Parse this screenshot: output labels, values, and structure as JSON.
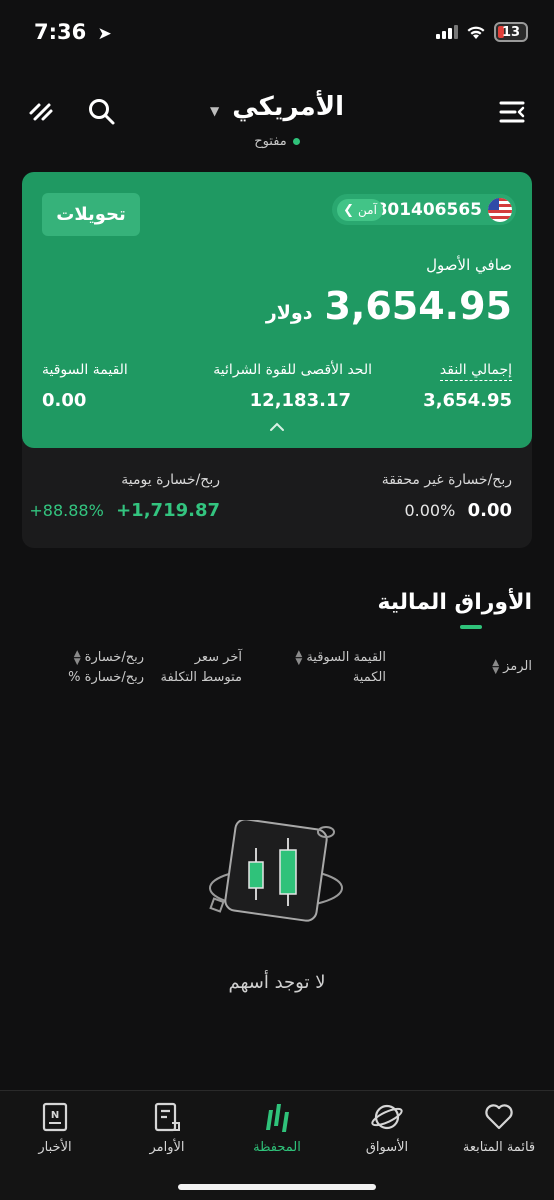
{
  "status_bar": {
    "time": "7:36",
    "battery": "13"
  },
  "header": {
    "title": "الأمريكي",
    "market_status": "مفتوح"
  },
  "account": {
    "transfers_label": "تحويلات",
    "account_number": "801406565",
    "safe_label": "آمن",
    "net_assets_label": "صافي الأصول",
    "net_assets_value": "3,654.95",
    "currency": "دولار",
    "stats": [
      {
        "label": "إجمالي النقد",
        "value": "3,654.95"
      },
      {
        "label": "الحد الأقصى للقوة الشرائية",
        "value": "12,183.17"
      },
      {
        "label": "القيمة السوقية",
        "value": "0.00"
      }
    ],
    "unrealized_pl_label": "ربح/خسارة غير محققة",
    "unrealized_pl_value": "0.00",
    "unrealized_pl_pct": "0.00%",
    "daily_pl_label": "ربح/خسارة يومية",
    "daily_pl_value": "+1,719.87",
    "daily_pl_pct": "+88.88%"
  },
  "securities": {
    "title": "الأوراق المالية",
    "columns": {
      "symbol": "الرمز",
      "market_value": "القيمة السوقية",
      "quantity": "الكمية",
      "last_price": "آخر سعر",
      "avg_cost": "متوسط التكلفة",
      "pl": "ربح/خسارة",
      "pl_pct": "ربح/خسارة %"
    },
    "empty_text": "لا توجد أسهم"
  },
  "nav": [
    {
      "label": "قائمة المتابعة",
      "icon": "heart-icon"
    },
    {
      "label": "الأسواق",
      "icon": "planet-icon"
    },
    {
      "label": "المحفظة",
      "icon": "portfolio-icon"
    },
    {
      "label": "الأوامر",
      "icon": "orders-icon"
    },
    {
      "label": "الأخبار",
      "icon": "news-icon"
    }
  ],
  "colors": {
    "accent": "#2fc27a",
    "card": "#1f9962",
    "background": "#101011"
  }
}
